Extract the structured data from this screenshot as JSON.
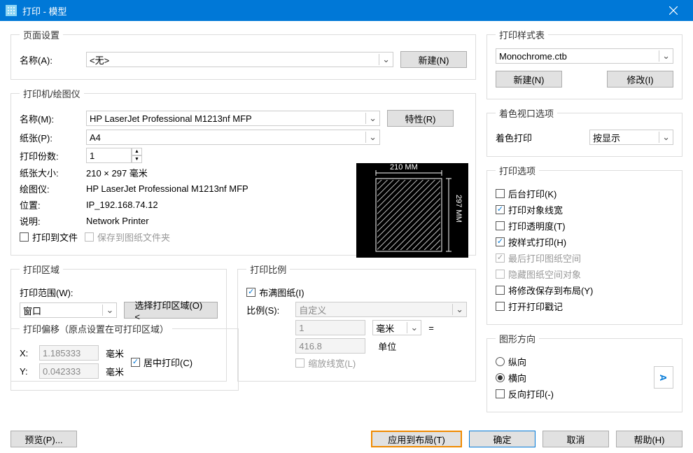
{
  "window": {
    "title": "打印 - 模型",
    "close": "×"
  },
  "page_setup": {
    "legend": "页面设置",
    "name_label": "名称(A):",
    "name_value": "<无>",
    "new_btn": "新建(N)"
  },
  "printer": {
    "legend": "打印机/绘图仪",
    "name_label": "名称(M):",
    "name_value": "HP LaserJet Professional M1213nf MFP",
    "props_btn": "特性(R)",
    "paper_label": "纸张(P):",
    "paper_value": "A4",
    "copies_label": "打印份数:",
    "copies_value": "1",
    "size_label": "纸张大小:",
    "size_value": "210 × 297 毫米",
    "plotter_label": "绘图仪:",
    "plotter_value": "HP LaserJet Professional M1213nf MFP",
    "loc_label": "位置:",
    "loc_value": "IP_192.168.74.12",
    "desc_label": "说明:",
    "desc_value": "Network Printer",
    "to_file": "打印到文件",
    "save_folder": "保存到图纸文件夹",
    "preview_w": "210 MM",
    "preview_h": "297 MM"
  },
  "area": {
    "legend": "打印区域",
    "range_label": "打印范围(W):",
    "range_value": "窗口",
    "select_btn": "选择打印区域(O)<"
  },
  "scale": {
    "legend": "打印比例",
    "fit": "布满图纸(I)",
    "ratio_label": "比例(S):",
    "ratio_value": "自定义",
    "a_value": "1",
    "unit": "毫米",
    "eq": "=",
    "b_value": "416.8",
    "unit2": "单位",
    "scale_lw": "缩放线宽(L)"
  },
  "offset": {
    "legend": "打印偏移（原点设置在可打印区域）",
    "x_label": "X:",
    "x_value": "1.185333",
    "y_label": "Y:",
    "y_value": "0.042333",
    "unit": "毫米",
    "center": "居中打印(C)"
  },
  "styles": {
    "legend": "打印样式表",
    "value": "Monochrome.ctb",
    "new_btn": "新建(N)",
    "edit_btn": "修改(I)"
  },
  "viewport": {
    "legend": "着色视口选项",
    "label": "着色打印",
    "value": "按显示"
  },
  "options": {
    "legend": "打印选项",
    "bg": "后台打印(K)",
    "lw": "打印对象线宽",
    "trans": "打印透明度(T)",
    "style": "按样式打印(H)",
    "last": "最后打印图纸空间",
    "hide": "隐藏图纸空间对象",
    "save": "将修改保存到布局(Y)",
    "stamp": "打开打印戳记"
  },
  "orient": {
    "legend": "图形方向",
    "portrait": "纵向",
    "landscape": "横向",
    "reverse": "反向打印(-)",
    "letter": "A"
  },
  "bottom": {
    "preview": "预览(P)...",
    "apply": "应用到布局(T)",
    "ok": "确定",
    "cancel": "取消",
    "help": "帮助(H)"
  }
}
